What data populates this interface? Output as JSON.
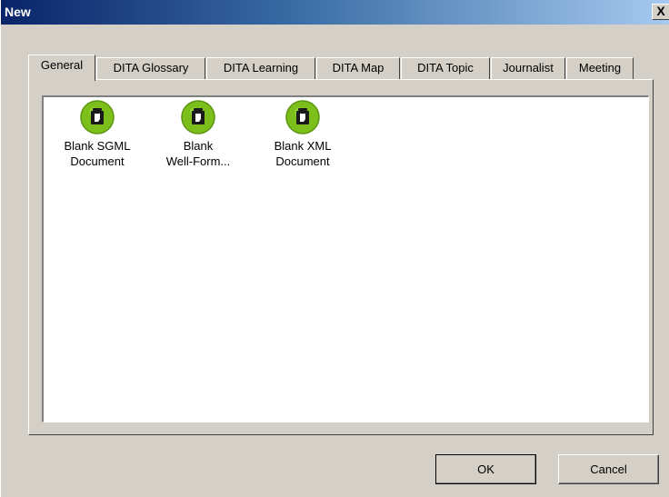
{
  "window": {
    "title": "New",
    "close_label": "X"
  },
  "tabs": [
    {
      "label": "General",
      "active": true
    },
    {
      "label": "DITA Glossary",
      "active": false
    },
    {
      "label": "DITA Learning",
      "active": false
    },
    {
      "label": "DITA Map",
      "active": false
    },
    {
      "label": "DITA Topic",
      "active": false
    },
    {
      "label": "Journalist",
      "active": false
    },
    {
      "label": "Meeting",
      "active": false
    }
  ],
  "items": [
    {
      "line1": "Blank SGML",
      "line2": "Document",
      "icon": "document-template-icon"
    },
    {
      "line1": "Blank",
      "line2": "Well-Form...",
      "icon": "document-template-icon"
    },
    {
      "line1": "Blank XML",
      "line2": "Document",
      "icon": "document-template-icon"
    }
  ],
  "buttons": {
    "ok_label": "OK",
    "cancel_label": "Cancel"
  },
  "colors": {
    "icon_green": "#7cbf1a",
    "titlebar_start": "#0a246a",
    "titlebar_end": "#a6caf0",
    "dialog_face": "#d4d0c8"
  }
}
